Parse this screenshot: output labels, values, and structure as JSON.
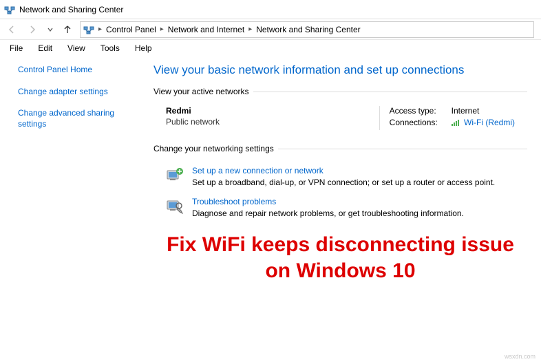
{
  "window": {
    "title": "Network and Sharing Center"
  },
  "breadcrumb": {
    "seg1": "Control Panel",
    "seg2": "Network and Internet",
    "seg3": "Network and Sharing Center"
  },
  "menu": {
    "file": "File",
    "edit": "Edit",
    "view": "View",
    "tools": "Tools",
    "help": "Help"
  },
  "sidebar": {
    "home": "Control Panel Home",
    "adapter": "Change adapter settings",
    "advanced": "Change advanced sharing settings"
  },
  "main": {
    "heading": "View your basic network information and set up connections",
    "active_label": "View your active networks",
    "network": {
      "name": "Redmi",
      "type": "Public network",
      "access_label": "Access type:",
      "access_value": "Internet",
      "conn_label": "Connections:",
      "conn_value": "Wi-Fi (Redmi)"
    },
    "change_label": "Change your networking settings",
    "setup": {
      "title": "Set up a new connection or network",
      "desc": "Set up a broadband, dial-up, or VPN connection; or set up a router or access point."
    },
    "troubleshoot": {
      "title": "Troubleshoot problems",
      "desc": "Diagnose and repair network problems, or get troubleshooting information."
    }
  },
  "banner": "Fix WiFi keeps disconnecting issue on Windows 10",
  "watermark": "wsxdn.com"
}
